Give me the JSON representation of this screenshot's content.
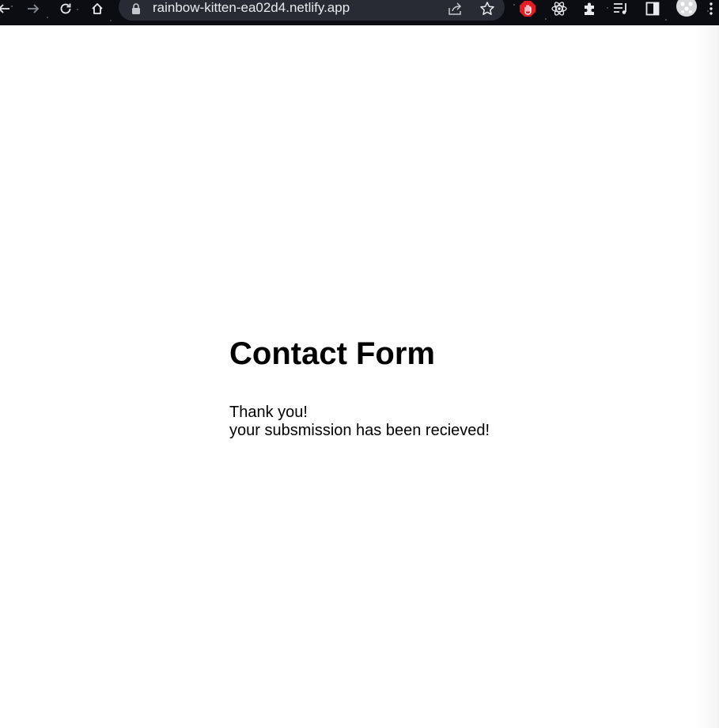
{
  "browser": {
    "url": "rainbow-kitten-ea02d4.netlify.app",
    "icons": {
      "back": "arrow-left-icon",
      "forward": "arrow-right-icon",
      "reload": "reload-icon",
      "home": "home-icon",
      "lock": "lock-icon",
      "share": "share-icon",
      "bookmark": "star-icon",
      "extension_blocker": "stop-hand-icon",
      "extension_react": "react-atom-icon",
      "extensions": "puzzle-icon",
      "media": "media-queue-icon",
      "side_panel": "side-panel-icon",
      "profile": "profile-avatar-icon"
    },
    "colors": {
      "toolbar": "#0b0d12",
      "omnibox": "#282b33",
      "blocker": "#e51c23"
    }
  },
  "page": {
    "title": "Contact Form",
    "line1": "Thank you!",
    "line2": "your subsmission has been recieved!"
  }
}
